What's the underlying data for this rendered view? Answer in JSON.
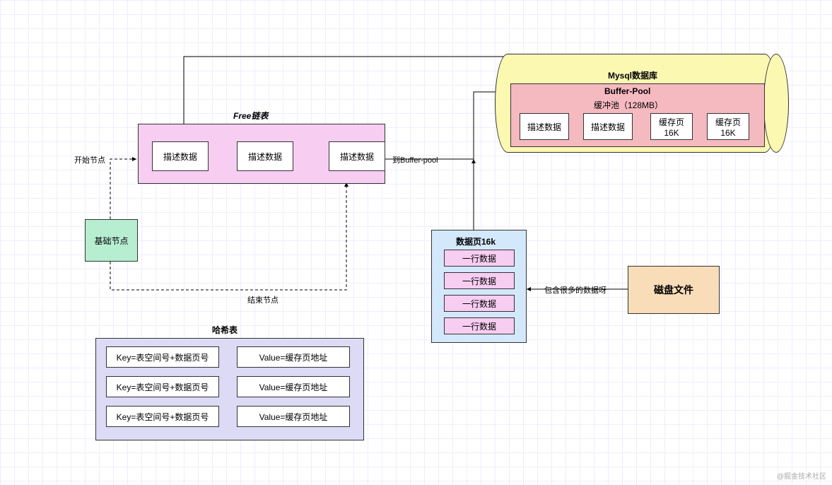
{
  "freeList": {
    "title": "Free链表",
    "nodes": [
      "描述数据",
      "描述数据",
      "描述数据"
    ]
  },
  "baseNode": {
    "label": "基础节点",
    "startLabel": "开始节点",
    "endLabel": "结束节点"
  },
  "hashTable": {
    "title": "哈希表",
    "rows": [
      {
        "key": "Key=表空间号+数据页号",
        "value": "Value=缓存页地址"
      },
      {
        "key": "Key=表空间号+数据页号",
        "value": "Value=缓存页地址"
      },
      {
        "key": "Key=表空间号+数据页号",
        "value": "Value=缓存页地址"
      }
    ]
  },
  "dataPage": {
    "title": "数据页16k",
    "rows": [
      "一行数据",
      "一行数据",
      "一行数据",
      "一行数据"
    ]
  },
  "diskFile": {
    "label": "磁盘文件",
    "edgeLabel": "包含很多的数据呀"
  },
  "mysql": {
    "title": "Mysql数据库",
    "pool": {
      "title": "Buffer-Pool",
      "subtitle": "缓冲池（128MB）",
      "boxes": [
        "描述数据",
        "描述数据",
        "缓存页\n16K",
        "缓存页\n16K"
      ]
    }
  },
  "edge1": "到Buffer-pool",
  "watermark": "@掘金技术社区"
}
